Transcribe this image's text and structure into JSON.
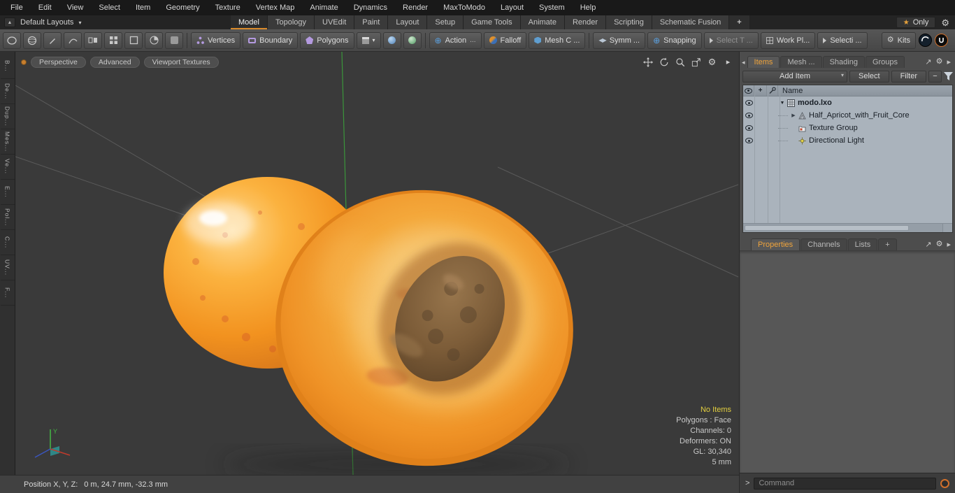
{
  "colors": {
    "accent": "#e89a3c",
    "tree_bg": "#aab3bc",
    "no_items_yellow": "#e3cf3f"
  },
  "menu": {
    "items": [
      "File",
      "Edit",
      "View",
      "Select",
      "Item",
      "Geometry",
      "Texture",
      "Vertex Map",
      "Animate",
      "Dynamics",
      "Render",
      "MaxToModo",
      "Layout",
      "System",
      "Help"
    ]
  },
  "layout_bar": {
    "preset": "Default Layouts",
    "tabs": [
      "Model",
      "Topology",
      "UVEdit",
      "Paint",
      "Layout",
      "Setup",
      "Game Tools",
      "Animate",
      "Render",
      "Scripting",
      "Schematic Fusion",
      "+"
    ],
    "only": "Only"
  },
  "toolbar": {
    "vertices": "Vertices",
    "boundary": "Boundary",
    "polygons": "Polygons",
    "action": "Action",
    "action_more": "...",
    "falloff": "Falloff",
    "mesh_constraints": "Mesh C ...",
    "symmetry": "Symm ...",
    "snapping": "Snapping",
    "select_through": "Select T ...",
    "work_plane": "Work Pl...",
    "selection_sets": "Selecti ...",
    "kits": "Kits"
  },
  "tool_strip": {
    "items": [
      "B...",
      "De...",
      "Dup...",
      "Mes...",
      "Ve...",
      "E...",
      "Pol...",
      "C...",
      "UV...",
      "F..."
    ]
  },
  "viewport": {
    "view_mode": "Perspective",
    "shading": "Advanced",
    "textures": "Viewport Textures",
    "axis_y": "Y",
    "stats": {
      "no_items": "No Items",
      "polygons": "Polygons : Face",
      "channels": "Channels: 0",
      "deformers": "Deformers: ON",
      "gl": "GL: 30,340",
      "scale": "5 mm"
    }
  },
  "status_bar": {
    "label": "Position X, Y, Z:",
    "value": "0 m, 24.7 mm, -32.3 mm"
  },
  "item_panel": {
    "tabs": [
      "Items",
      "Mesh ...",
      "Shading",
      "Groups"
    ],
    "add_item": "Add Item",
    "select": "Select",
    "filter": "Filter",
    "name_column": "Name",
    "tree": {
      "root": "modo.lxo",
      "children": [
        "Half_Apricot_with_Fruit_Core",
        "Texture Group",
        "Directional Light"
      ]
    }
  },
  "properties_panel": {
    "tabs": [
      "Properties",
      "Channels",
      "Lists",
      "+"
    ]
  },
  "command_bar": {
    "prompt": ">",
    "placeholder": "Command"
  },
  "icons": {
    "dropdown": "▾",
    "up": "▲",
    "back": "◂",
    "expand_open": "▼",
    "expand_closed": "▶",
    "star": "★",
    "gear": "⚙",
    "play": "▸",
    "maximize": "↗",
    "minus": "−",
    "plus": "+",
    "plus_circle": "⊕",
    "mirror": "◀▶"
  }
}
